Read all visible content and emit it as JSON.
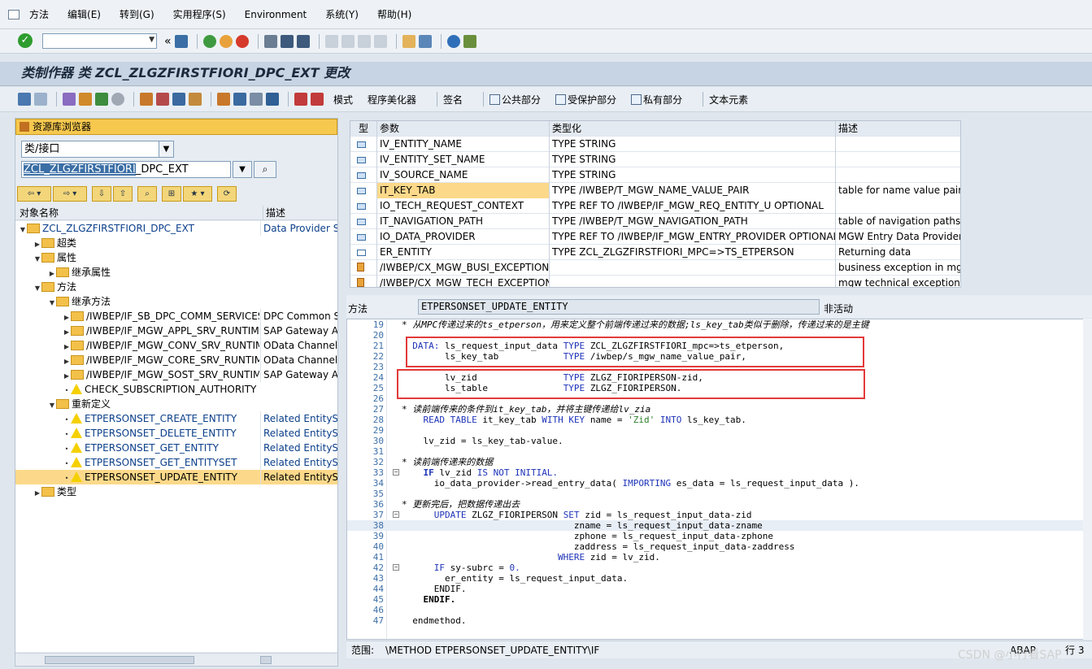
{
  "menu": {
    "items": [
      "方法",
      "编辑(E)",
      "转到(G)",
      "实用程序(S)",
      "Environment",
      "系统(Y)",
      "帮助(H)"
    ]
  },
  "title": "类制作器 类 ZCL_ZLGZFIRSTFIORI_DPC_EXT 更改",
  "app_toolbar": {
    "items": [
      "模式",
      "程序美化器",
      "签名",
      "公共部分",
      "受保护部分",
      "私有部分",
      "文本元素"
    ]
  },
  "left_panel": {
    "header": "资源库浏览器",
    "object_type": "类/接口",
    "object_name_selected": "ZCL_ZLGZFIRSTFIORI",
    "object_name_rest": "_DPC_EXT",
    "col_name": "对象名称",
    "col_desc": "描述",
    "tree": [
      {
        "name": "ZCL_ZLGZFIRSTFIORI_DPC_EXT",
        "desc": "Data Provider Sec"
      },
      {
        "name": "超类",
        "desc": ""
      },
      {
        "name": "属性",
        "desc": ""
      },
      {
        "name": "继承属性",
        "desc": ""
      },
      {
        "name": "方法",
        "desc": ""
      },
      {
        "name": "继承方法",
        "desc": ""
      },
      {
        "name": "/IWBEP/IF_SB_DPC_COMM_SERVICES",
        "desc": "DPC Common Ser"
      },
      {
        "name": "/IWBEP/IF_MGW_APPL_SRV_RUNTIME",
        "desc": "SAP Gateway Ap"
      },
      {
        "name": "/IWBEP/IF_MGW_CONV_SRV_RUNTIME",
        "desc": "OData Channel -"
      },
      {
        "name": "/IWBEP/IF_MGW_CORE_SRV_RUNTIME",
        "desc": "OData Channel -"
      },
      {
        "name": "/IWBEP/IF_MGW_SOST_SRV_RUNTIME",
        "desc": "SAP Gateway Ap"
      },
      {
        "name": "CHECK_SUBSCRIPTION_AUTHORITY",
        "desc": ""
      },
      {
        "name": "重新定义",
        "desc": ""
      },
      {
        "name": "ETPERSONSET_CREATE_ENTITY",
        "desc": "Related EntitySet"
      },
      {
        "name": "ETPERSONSET_DELETE_ENTITY",
        "desc": "Related EntitySet"
      },
      {
        "name": "ETPERSONSET_GET_ENTITY",
        "desc": "Related EntitySet"
      },
      {
        "name": "ETPERSONSET_GET_ENTITYSET",
        "desc": "Related EntitySet"
      },
      {
        "name": "ETPERSONSET_UPDATE_ENTITY",
        "desc": "Related EntitySet"
      },
      {
        "name": "类型",
        "desc": ""
      }
    ]
  },
  "params": {
    "headers": [
      "型",
      "参数",
      "类型化",
      "描述"
    ],
    "rows": [
      {
        "name": "IV_ENTITY_NAME",
        "typing": "TYPE STRING",
        "desc": ""
      },
      {
        "name": "IV_ENTITY_SET_NAME",
        "typing": "TYPE STRING",
        "desc": ""
      },
      {
        "name": "IV_SOURCE_NAME",
        "typing": "TYPE STRING",
        "desc": ""
      },
      {
        "name": "IT_KEY_TAB",
        "typing": "TYPE /IWBEP/T_MGW_NAME_VALUE_PAIR",
        "desc": "table for name value pairs"
      },
      {
        "name": "IO_TECH_REQUEST_CONTEXT",
        "typing": "TYPE REF TO /IWBEP/IF_MGW_REQ_ENTITY_U OPTIONAL",
        "desc": ""
      },
      {
        "name": "IT_NAVIGATION_PATH",
        "typing": "TYPE /IWBEP/T_MGW_NAVIGATION_PATH",
        "desc": "table of navigation paths"
      },
      {
        "name": "IO_DATA_PROVIDER",
        "typing": "TYPE REF TO /IWBEP/IF_MGW_ENTRY_PROVIDER OPTIONAL",
        "desc": "MGW Entry Data Provider"
      },
      {
        "name": "ER_ENTITY",
        "typing": "TYPE ZCL_ZLGZFIRSTFIORI_MPC=>TS_ETPERSON",
        "desc": "Returning data"
      },
      {
        "name": "/IWBEP/CX_MGW_BUSI_EXCEPTION",
        "typing": "",
        "desc": "business exception in mgw"
      },
      {
        "name": "/IWBEP/CX_MGW_TECH_EXCEPTION",
        "typing": "",
        "desc": "mgw technical exception"
      }
    ]
  },
  "method_bar": {
    "label": "方法",
    "method": "ETPERSONSET_UPDATE_ENTITY",
    "status": "非活动"
  },
  "code": {
    "l19": "* 从MPC传递过来的ts_etperson，用来定义整个前端传递过来的数据;ls_key_tab类似于删除，传递过来的是主键",
    "l21a": "  DATA: ",
    "l21b": "ls_request_input_data ",
    "l21c": "TYPE ",
    "l21d": "ZCL_ZLGZFIRSTFIORI_mpc=>ts_etperson,",
    "l22a": "        ls_key_tab            ",
    "l22b": "TYPE ",
    "l22c": "/iwbep/s_mgw_name_value_pair,",
    "l24a": "        lv_zid                ",
    "l24b": "TYPE ",
    "l24c": "ZLGZ_FIORIPERSON-zid,",
    "l25a": "        ls_table              ",
    "l25b": "TYPE ",
    "l25c": "ZLGZ_FIORIPERSON.",
    "l27": "* 读前端传来的条件到it_key_tab，并将主键传递给lv_zia",
    "l28a": "    READ TABLE ",
    "l28b": "it_key_tab ",
    "l28c": "WITH KEY ",
    "l28d": "name = ",
    "l28e": "'Zid'",
    "l28f": " INTO ",
    "l28g": "ls_key_tab.",
    "l30": "    lv_zid = ls_key_tab-value.",
    "l32": "* 读前端传递来的数据",
    "l33a": "    IF ",
    "l33b": "lv_zid ",
    "l33c": "IS NOT INITIAL.",
    "l34a": "      io_data_provider->read_entry_data( ",
    "l34b": "IMPORTING ",
    "l34c": "es_data = ls_request_input_data ).",
    "l36": "* 更新完后，把数据传递出去",
    "l37a": "      UPDATE ",
    "l37b": "ZLGZ_FIORIPERSON ",
    "l37c": "SET ",
    "l37d": "zid = ls_request_input_data-zid",
    "l38": "                                zname = ls_request_input_data-zname",
    "l39": "                                zphone = ls_request_input_data-zphone",
    "l40": "                                zaddress = ls_request_input_data-zaddress",
    "l41a": "                             WHERE ",
    "l41b": "zid = lv_zid.",
    "l42a": "      IF ",
    "l42b": "sy-subrc = ",
    "l42c": "0.",
    "l43": "        er_entity = ls_request_input_data.",
    "l44": "      ENDIF.",
    "l45": "    ENDIF.",
    "l47": "  endmethod."
  },
  "status_bar": {
    "scope_label": "范围:",
    "scope_value": "\\METHOD ETPERSONSET_UPDATE_ENTITY\\IF",
    "lang": "ABAP",
    "row": "行 3"
  },
  "watermark": "CSDN @小行看SAP",
  "colors": {
    "highlight": "#fcd98a",
    "keyword": "#1e33b8",
    "comment": "#6a7a90",
    "annotation_box": "#e23a3a"
  }
}
